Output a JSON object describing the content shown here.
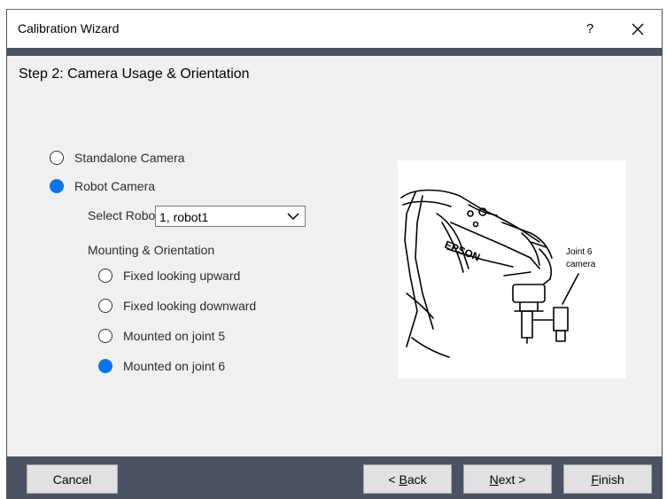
{
  "window": {
    "title": "Calibration Wizard",
    "help_label": "?",
    "close_icon": "close-icon"
  },
  "step": {
    "title": "Step 2: Camera Usage & Orientation"
  },
  "camera_usage": {
    "options": [
      {
        "label": "Standalone Camera",
        "checked": false
      },
      {
        "label": "Robot Camera",
        "checked": true
      }
    ]
  },
  "robot_select": {
    "label": "Select Robot:",
    "value": "1, robot1"
  },
  "mounting": {
    "label": "Mounting & Orientation",
    "options": [
      {
        "label": "Fixed looking upward",
        "checked": false
      },
      {
        "label": "Fixed looking downward",
        "checked": false
      },
      {
        "label": "Mounted on joint 5",
        "checked": false
      },
      {
        "label": "Mounted on joint 6",
        "checked": true
      }
    ]
  },
  "illustration": {
    "brand": "EPSON",
    "callout_line1": "Joint 6",
    "callout_line2": "camera"
  },
  "buttons": {
    "cancel": "Cancel",
    "back_prefix": "< ",
    "back_mnemonic": "B",
    "back_rest": "ack",
    "next_mnemonic": "N",
    "next_rest": "ext >",
    "finish_mnemonic": "F",
    "finish_rest": "inish"
  },
  "colors": {
    "accent": "#0a74ee",
    "frame": "#4b5261",
    "panel": "#f0f0f0"
  }
}
